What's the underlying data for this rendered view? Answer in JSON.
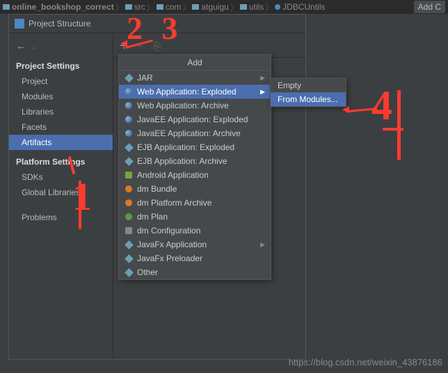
{
  "breadcrumbs": {
    "project": "online_bookshop_correct",
    "parts": [
      "src",
      "com",
      "atguigu",
      "utils",
      "JDBCUntils"
    ]
  },
  "top_add_btn": "Add C",
  "dialog": {
    "title": "Project Structure"
  },
  "sidebar": {
    "head1": "Project Settings",
    "items1": [
      "Project",
      "Modules",
      "Libraries",
      "Facets",
      "Artifacts"
    ],
    "head2": "Platform Settings",
    "items2": [
      "SDKs",
      "Global Libraries"
    ],
    "problems": "Problems"
  },
  "popup": {
    "title": "Add",
    "items": [
      {
        "label": "JAR",
        "icon": "diamond",
        "arrow": true
      },
      {
        "label": "Web Application: Exploded",
        "icon": "sphere",
        "arrow": true,
        "selected": true
      },
      {
        "label": "Web Application: Archive",
        "icon": "sphere"
      },
      {
        "label": "JavaEE Application: Exploded",
        "icon": "sphere"
      },
      {
        "label": "JavaEE Application: Archive",
        "icon": "sphere"
      },
      {
        "label": "EJB Application: Exploded",
        "icon": "diamond"
      },
      {
        "label": "EJB Application: Archive",
        "icon": "diamond"
      },
      {
        "label": "Android Application",
        "icon": "android"
      },
      {
        "label": "dm Bundle",
        "icon": "orange"
      },
      {
        "label": "dm Platform Archive",
        "icon": "orange"
      },
      {
        "label": "dm Plan",
        "icon": "green"
      },
      {
        "label": "dm Configuration",
        "icon": "gray"
      },
      {
        "label": "JavaFx Application",
        "icon": "diamond",
        "arrow": true
      },
      {
        "label": "JavaFx Preloader",
        "icon": "diamond"
      },
      {
        "label": "Other",
        "icon": "diamond"
      }
    ]
  },
  "submenu": {
    "items": [
      {
        "label": "Empty"
      },
      {
        "label": "From Modules...",
        "selected": true
      }
    ]
  },
  "annotations": {
    "n23": "2 3",
    "n1": "1",
    "n4": "4"
  },
  "watermark": "https://blog.csdn.net/weixin_43876186"
}
